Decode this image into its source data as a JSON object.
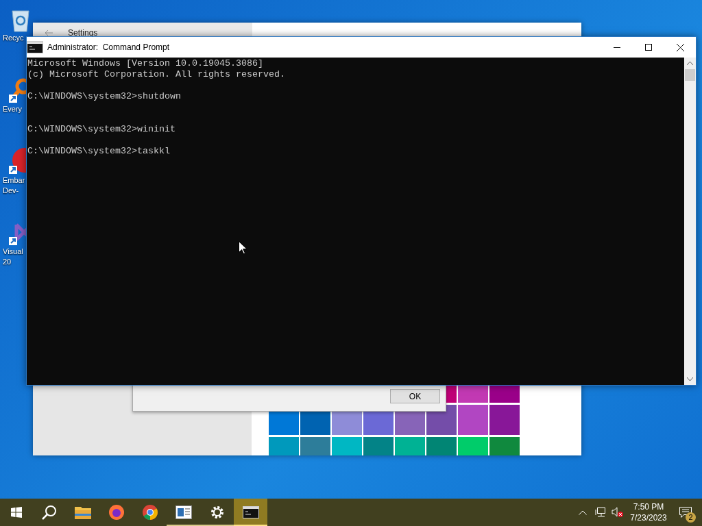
{
  "desktop": {
    "icons": [
      {
        "kind": "bin",
        "label": [
          "Recyc"
        ]
      },
      {
        "kind": "magnifier",
        "label": [
          "Every"
        ]
      },
      {
        "kind": "redbadge",
        "label": [
          "Embar",
          "Dev-"
        ]
      },
      {
        "kind": "ribbon",
        "label": [
          "Visual",
          "20"
        ]
      }
    ]
  },
  "settings_window": {
    "title": "Settings",
    "swatch_rows": [
      [
        {
          "color": "#bf0077"
        },
        {
          "color": "#c239b3"
        },
        {
          "color": "#9a0089"
        }
      ],
      [
        {
          "color": "#0078d7"
        },
        {
          "color": "#0063b1"
        },
        {
          "color": "#8e8cd8"
        },
        {
          "color": "#6b69d6"
        },
        {
          "color": "#8764b8"
        },
        {
          "color": "#744da9"
        },
        {
          "color": "#b146c2"
        },
        {
          "color": "#881798"
        }
      ],
      [
        {
          "color": "#0099bc"
        },
        {
          "color": "#2d7d9a"
        },
        {
          "color": "#00b7c3"
        },
        {
          "color": "#038387"
        },
        {
          "color": "#00b294"
        },
        {
          "color": "#018574"
        },
        {
          "color": "#00cc6a"
        },
        {
          "color": "#10893e"
        }
      ]
    ]
  },
  "dialog": {
    "button": "OK"
  },
  "command_window": {
    "title": "Administrator:  Command Prompt",
    "lines": [
      {
        "kind": "text",
        "text": "Microsoft Windows [Version 10.0.19045.3086]"
      },
      {
        "kind": "text",
        "text": "(c) Microsoft Corporation. All rights reserved."
      },
      {
        "kind": "blank"
      },
      {
        "kind": "text",
        "text": "C:\\WINDOWS\\system32>shutdown"
      },
      {
        "kind": "blank"
      },
      {
        "kind": "blank"
      },
      {
        "kind": "text",
        "text": "C:\\WINDOWS\\system32>wininit"
      },
      {
        "kind": "blank"
      },
      {
        "kind": "text",
        "text": "C:\\WINDOWS\\system32>taskkl"
      }
    ]
  },
  "taskbar": {
    "apps": [
      {
        "kind": "folder",
        "running": false,
        "selected": false
      },
      {
        "kind": "browser-orange",
        "running": false,
        "selected": false
      },
      {
        "kind": "browser-ring",
        "running": false,
        "selected": false
      },
      {
        "kind": "reader",
        "running": true,
        "selected": false
      },
      {
        "kind": "gear",
        "running": true,
        "selected": false
      },
      {
        "kind": "console",
        "running": true,
        "selected": true
      }
    ],
    "clock": {
      "time": "7:50 PM",
      "date": "7/23/2023"
    },
    "notifications": {
      "count": "2"
    }
  }
}
